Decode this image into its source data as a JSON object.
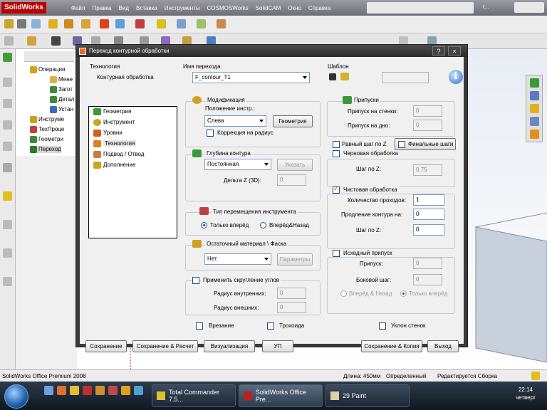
{
  "app": {
    "logo": "SolidWorks",
    "menu": [
      "Файл",
      "Правка",
      "Вид",
      "Вставка",
      "Инструменты",
      "COSMOSWorks",
      "SolidCAM",
      "Окно",
      "Справка"
    ],
    "title_tail": "г..."
  },
  "tree": {
    "items": [
      "Операции",
      "Мене",
      "Загот",
      "Детал",
      "Устан",
      "Инструме",
      "ТехПроце",
      "Геометри",
      "Переход"
    ]
  },
  "dialog": {
    "title": "Переход контурной обработки",
    "tech_label": "Технология",
    "tech_value": "Контурная обработка",
    "name_label": "Имя перехода",
    "name_value": "F_contour_T1",
    "template_label": "Шаблон",
    "nav": [
      "Геометрия",
      "Инструмент",
      "Уровни",
      "Технология",
      "Подвод / Отвод",
      "Дополнение"
    ],
    "nav_selected": 3,
    "mod": {
      "title": "Модификация",
      "pos_label": "Положение инстр.:",
      "pos_value": "Слева",
      "geom_button": "Геометрия",
      "radius_corr": "Коррекция на радиус"
    },
    "depth": {
      "title": "Глубина контура",
      "value": "Постоянная",
      "specify_button": "Указать",
      "delta_label": "Дельта Z (3D):",
      "delta_value": "0"
    },
    "move": {
      "title": "Тип перемещения инструмента",
      "opt1": "Только вперёд",
      "opt2": "Вперёд&Назад"
    },
    "rest": {
      "title": "Остаточный материал \\ Фаска",
      "value": "Нет",
      "params_button": "Параметры"
    },
    "rounding": {
      "title": "Применить скругление углов",
      "inner_label": "Радиус внутренних:",
      "inner_value": "0",
      "outer_label": "Радиус внешних:",
      "outer_value": "0"
    },
    "allowance": {
      "title": "Припуски",
      "wall_label": "Припуск на стенки:",
      "wall_value": "0",
      "floor_label": "Припуск на дно:",
      "floor_value": "0"
    },
    "equal_step": "Равный шаг по Z",
    "final_steps": "Финальные шаги",
    "rough": {
      "title": "Черновая обработка",
      "stepz_label": "Шаг по Z:",
      "stepz_value": "0.75"
    },
    "finish": {
      "title": "Чистовая обработка",
      "passes_label": "Количество проходов:",
      "passes_value": "1",
      "extend_label": "Продление контура на:",
      "extend_value": "0",
      "stepz_label": "Шаг по Z:",
      "stepz_value": "0"
    },
    "initial": {
      "title": "Исходный припуск",
      "allow_label": "Припуск:",
      "allow_value": "0",
      "side_label": "Боковой шаг:",
      "side_value": "0",
      "opt1": "Вперёд & Назад",
      "opt2": "Только вперёд"
    },
    "check_plunge": "Врезание",
    "check_trochoid": "Трохоида",
    "check_wall_slope": "Уклон стенок",
    "buttons": {
      "save": "Сохранение",
      "save_calc": "Сохранение & Расчет",
      "visualize": "Визуализация",
      "up": "УП",
      "save_copy": "Сохранение & Копия",
      "exit": "Выход"
    },
    "controls": {
      "help": "?",
      "close": "×"
    }
  },
  "status": {
    "product": "SolidWorks Office Premium 2008",
    "length": "Длина: 450мм",
    "state": "Определенный",
    "editing": "Редактируется Сборка"
  },
  "taskbar": {
    "items": [
      "Total Commander 7.5...",
      "SolidWorks Office Pre...",
      "29 Paint"
    ],
    "time": "22:14",
    "day": "четверг"
  },
  "colors": {
    "accent": "#1c5180",
    "title_dark": "#2a2a2a",
    "taskbar": "#0f1822"
  }
}
